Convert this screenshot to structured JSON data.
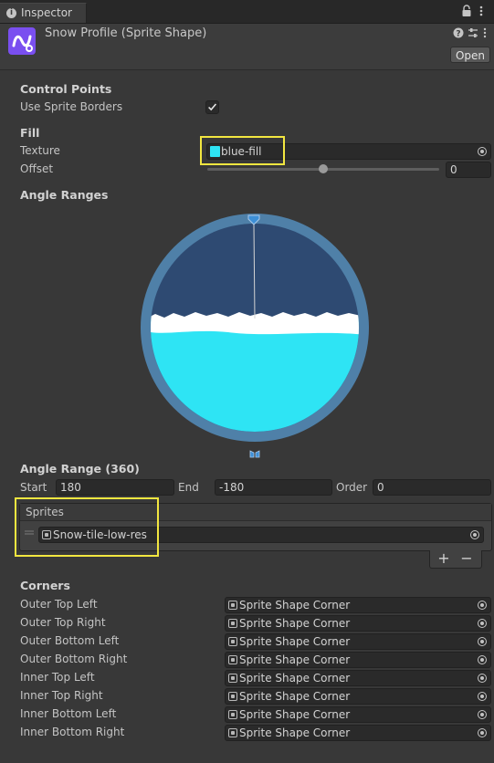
{
  "tab": {
    "icon": "info-icon",
    "label": "Inspector"
  },
  "header": {
    "title": "Snow Profile (Sprite Shape)",
    "open_label": "Open"
  },
  "control_points": {
    "heading": "Control Points",
    "use_sprite_borders_label": "Use Sprite Borders",
    "use_sprite_borders_checked": true
  },
  "fill": {
    "heading": "Fill",
    "texture_label": "Texture",
    "texture_value": "blue-fill",
    "offset_label": "Offset",
    "offset_value": "0",
    "offset_slider_level": 0.5
  },
  "angle_ranges": {
    "heading": "Angle Ranges"
  },
  "angle_range": {
    "heading": "Angle Range (360)",
    "start_label": "Start",
    "start_value": "180",
    "end_label": "End",
    "end_value": "-180",
    "order_label": "Order",
    "order_value": "0"
  },
  "sprites": {
    "heading": "Sprites",
    "items": [
      "Snow-tile-low-res"
    ],
    "add_label": "+",
    "remove_label": "−"
  },
  "corners": {
    "heading": "Corners",
    "rows": [
      {
        "label": "Outer Top Left",
        "value": "Sprite Shape Corner"
      },
      {
        "label": "Outer Top Right",
        "value": "Sprite Shape Corner"
      },
      {
        "label": "Outer Bottom Left",
        "value": "Sprite Shape Corner"
      },
      {
        "label": "Outer Bottom Right",
        "value": "Sprite Shape Corner"
      },
      {
        "label": "Inner Top Left",
        "value": "Sprite Shape Corner"
      },
      {
        "label": "Inner Top Right",
        "value": "Sprite Shape Corner"
      },
      {
        "label": "Inner Bottom Left",
        "value": "Sprite Shape Corner"
      },
      {
        "label": "Inner Bottom Right",
        "value": "Sprite Shape Corner"
      }
    ]
  },
  "colors": {
    "background": "#383838",
    "highlight": "#f2e640",
    "fill_cyan": "#2ee4f4",
    "ring": "#4f80a8",
    "asset_purple": "#7a4ff0"
  }
}
